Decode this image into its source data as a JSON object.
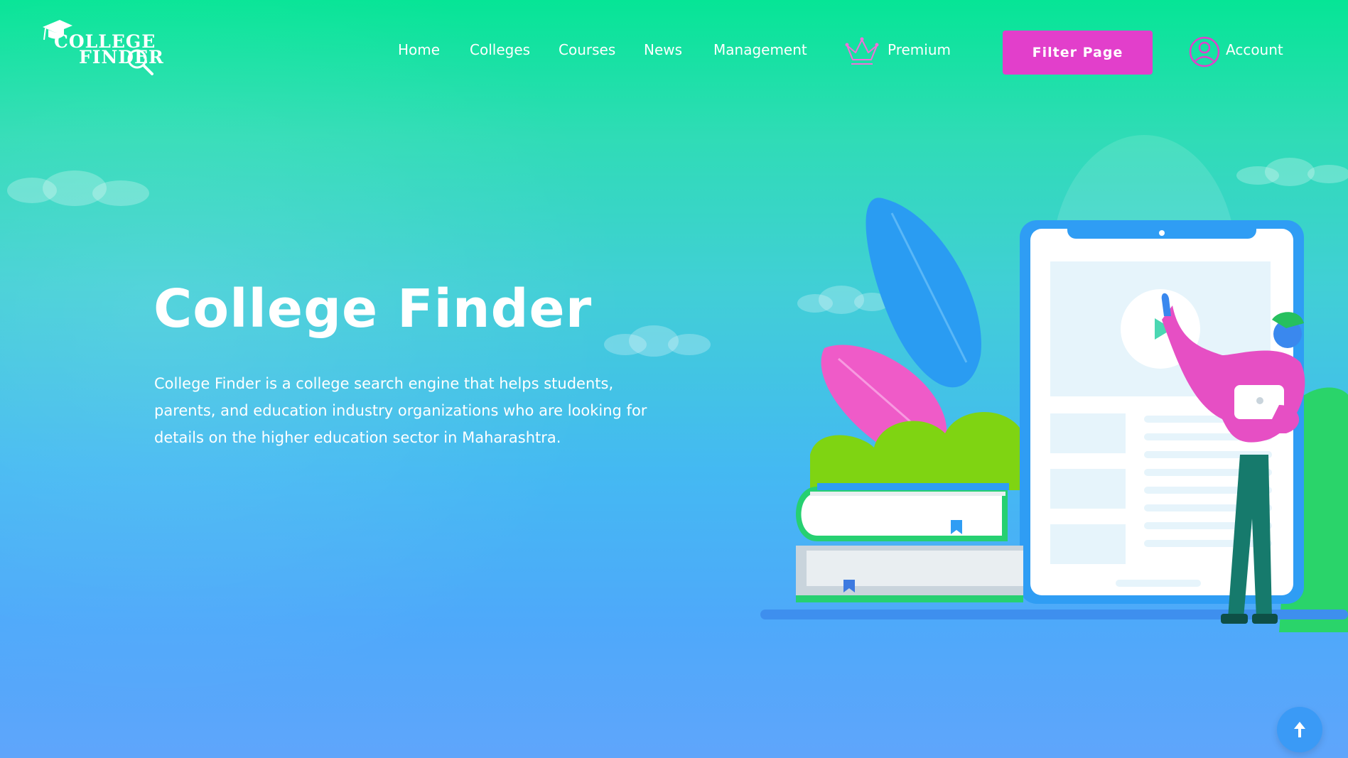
{
  "header": {
    "logo": {
      "line1": "COLLEGE",
      "line2": "FINDER"
    },
    "nav": [
      {
        "label": "Home"
      },
      {
        "label": "Colleges"
      },
      {
        "label": "Courses"
      },
      {
        "label": "News"
      },
      {
        "label": "Management"
      },
      {
        "label": "Premium",
        "icon": "crown-icon"
      }
    ],
    "filter_button": "Filter Page",
    "account": {
      "label": "Account",
      "icon": "user-circle-icon"
    }
  },
  "hero": {
    "title": "College Finder",
    "description": "College Finder is a college search engine that helps students, parents, and education industry organizations who are looking for details on the higher education sector in Maharashtra."
  },
  "scroll_top": {
    "icon": "arrow-up-icon"
  },
  "colors": {
    "gradient_top": "#06e596",
    "gradient_bottom": "#5fa5fb",
    "accent": "#e23fcb",
    "scroll_button": "#3a9af6"
  }
}
